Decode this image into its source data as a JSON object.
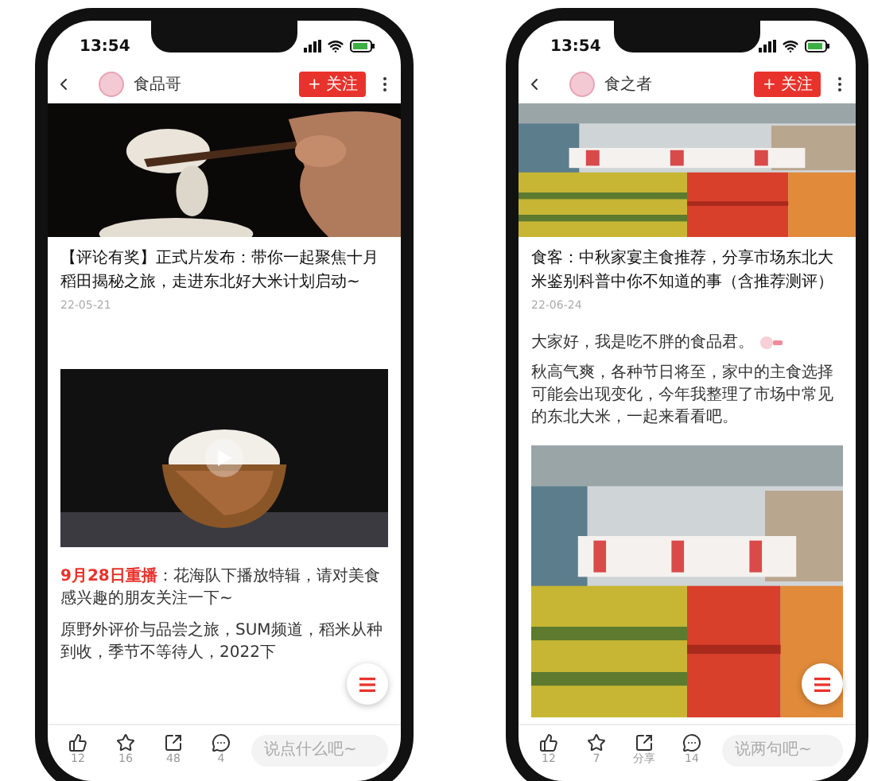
{
  "phones": [
    {
      "status_time": "13:54",
      "author": "食品哥",
      "follow_label": "+ 关注",
      "blocks": [
        {
          "kind": "picture"
        },
        {
          "kind": "title",
          "text": "【评论有奖】正式片发布：带你一起聚焦十月稻田揭秘之旅，走进东北好大米计划启动~"
        },
        {
          "kind": "date",
          "text": "22-05-21"
        },
        {
          "kind": "video"
        },
        {
          "kind": "paragraph",
          "text": "**9月28日重播**：花海队下播放特辑，请对美食感兴趣的朋友关注一下~"
        },
        {
          "kind": "paragraph",
          "text": "原野外评价与品尝之旅，SUM频道，稻米从种到收，季节不等待人，2022下"
        }
      ],
      "actions": [
        "12",
        "16",
        "48",
        "4"
      ],
      "comment_placeholder": "说点什么吧~"
    },
    {
      "status_time": "13:54",
      "author": "食之者",
      "follow_label": "+ 关注",
      "blocks": [
        {
          "kind": "picture"
        },
        {
          "kind": "title",
          "text": "食客：中秋家宴主食推荐，分享市场东北大米鉴别科普中你不知道的事（含推荐测评）"
        },
        {
          "kind": "date",
          "text": "22-06-24"
        },
        {
          "kind": "greeting",
          "text": "大家好，我是吃不胖的食品君。"
        },
        {
          "kind": "paragraph",
          "text": "秋高气爽，各种节日将至，家中的主食选择可能会出现变化，今年我整理了市场中常见的东北大米，一起来看看吧。"
        },
        {
          "kind": "picture"
        }
      ],
      "actions": [
        "12",
        "7",
        "分享",
        "14"
      ],
      "comment_placeholder": "说两句吧~"
    }
  ]
}
